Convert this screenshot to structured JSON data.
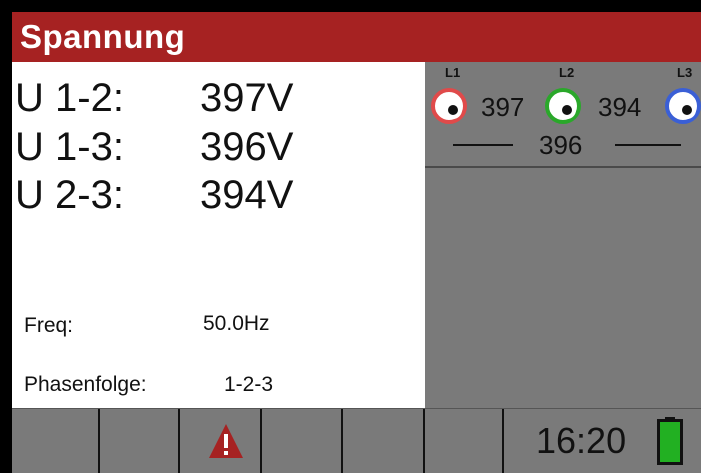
{
  "header": {
    "title": "Spannung"
  },
  "voltages": [
    {
      "label": "U 1-2:",
      "value": "397V"
    },
    {
      "label": "U 1-3:",
      "value": "396V"
    },
    {
      "label": "U 2-3:",
      "value": "394V"
    }
  ],
  "info": {
    "freq_label": "Freq:",
    "freq_value": "50.0Hz",
    "phase_label": "Phasenfolge:",
    "phase_value": "1-2-3"
  },
  "phase_diagram": {
    "l1_label": "L1",
    "l2_label": "L2",
    "l3_label": "L3",
    "l1_l2_value": "397",
    "l2_l3_value": "394",
    "l1_l3_value": "396",
    "l1_color": "#e04a4a",
    "l2_color": "#2aa82a",
    "l3_color": "#3a5fd6"
  },
  "status_bar": {
    "warning_icon": "warning-triangle-icon",
    "time": "16:20",
    "battery_icon": "battery-full-icon",
    "battery_color": "#22b022"
  },
  "colors": {
    "header_bg": "#a62222",
    "panel_gray": "#7a7a7a"
  }
}
